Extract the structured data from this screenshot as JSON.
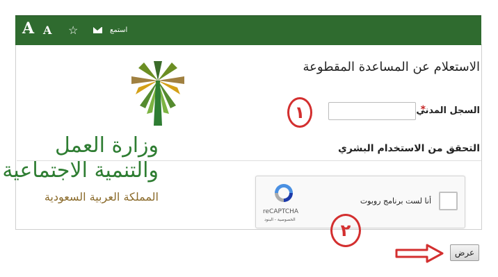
{
  "toolbar": {
    "font_large": "A",
    "font_small": "A",
    "favorite_icon": "star-outline-icon",
    "mail_icon": "envelope-icon",
    "listen_label": "استمع"
  },
  "page": {
    "title": "الاستعلام عن المساعدة المقطوعة"
  },
  "logo": {
    "line1": "وزارة العمل",
    "line2": "والتنمية الاجتماعية",
    "line3": "المملكة العربية السعودية"
  },
  "form": {
    "civil_id_label": "السجل المدني",
    "required_mark": "*",
    "civil_id_value": ""
  },
  "verification": {
    "section_title": "التحقق من الاستخدام البشري",
    "checkbox_label": "أنا لست برنامج روبوت",
    "brand": "reCAPTCHA",
    "terms": "الخصوصية - البنود"
  },
  "actions": {
    "submit_label": "عرض"
  },
  "annotations": {
    "step1": "١",
    "step2": "٢"
  },
  "colors": {
    "header_green": "#2f6b2f",
    "annotation_red": "#d32f2f",
    "logo_green": "#2e7d32",
    "logo_gold": "#8a6a2a"
  }
}
